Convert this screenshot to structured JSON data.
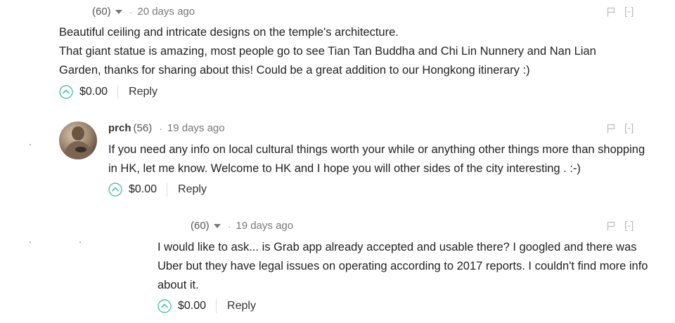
{
  "comments": [
    {
      "author": "",
      "reputation": "(60)",
      "separator": "·",
      "time": "20 days ago",
      "collapse": "[-]",
      "paragraphs": [
        "Beautiful ceiling and intricate designs on the temple's architecture.",
        "That giant statue is amazing, most people go to see Tian Tan Buddha and Chi Lin Nunnery and Nan Lian Garden, thanks for sharing about this! Could be a great addition to our Hongkong itinerary :)"
      ],
      "payout": "$0.00",
      "reply_label": "Reply"
    },
    {
      "author": "prch",
      "reputation": "(56)",
      "separator": "·",
      "time": "19 days ago",
      "collapse": "[-]",
      "paragraphs": [
        "If you need any info on local cultural things worth your while or anything other things more than shopping in HK, let me know. Welcome to HK and I hope you will other sides of the city interesting . :-)"
      ],
      "payout": "$0.00",
      "reply_label": "Reply"
    },
    {
      "author": "",
      "reputation": "(60)",
      "separator": "·",
      "time": "19 days ago",
      "collapse": "[-]",
      "paragraphs": [
        "I would like to ask... is Grab app already accepted and usable there? I googled and there was Uber but they have legal issues on operating according to 2017 reports. I couldn't find more info about it."
      ],
      "payout": "$0.00",
      "reply_label": "Reply"
    }
  ],
  "colors": {
    "upvote": "#4cc3a3",
    "flag": "#c0c0c0",
    "meta": "#777777",
    "text": "#222222"
  },
  "icons": {
    "upvote": "chevron-up-circle-icon",
    "flag": "flag-icon",
    "menu": "caret-down-icon"
  }
}
